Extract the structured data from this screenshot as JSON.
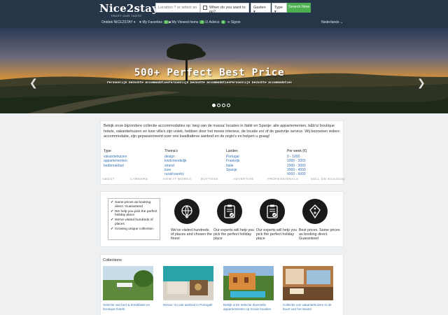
{
  "header": {
    "logo": "Nice2stay",
    "tagline": "TRUST OUR TASTE",
    "search_placeholder": "Location ? or select an accommodation",
    "date_placeholder": "When do you want to go?",
    "guests_label": "Gasten",
    "type_label": "Type",
    "search_button": "Search Now"
  },
  "nav": {
    "about": "Ontdek NICE2STAY",
    "favorites": "My Favorites",
    "favorites_count": "0",
    "viewed": "My Viewed Items",
    "viewed_count": "0",
    "advice": "Advice",
    "advice_count": "0",
    "signin": "Signin",
    "language": "Nederlands"
  },
  "hero": {
    "title": "500+   Perfect  Best Price",
    "subtitle": "Persoonlijk bezochte accommodatiesPersoonlijk bezochte accommodatiesPersoonlijk bezochte accommodaties",
    "slide_active": 1,
    "slide_count": 4
  },
  "intro": {
    "text": "Bekijk onze bijzondere collectie accommodaties op 'weg van de massa' locaties in Italië en Spanje: alle appartementen, b&b's/ boutique hotels, vakantiehuizen en luxe villa's zijn uniek, hebben door het mooie interieur, de locatie en/ of de gastvrije service. Wij bezoeken iedere accommodatie, zijn gepassioneerd over ons kwalitatieve aanbod en de regio's en helpen u graag!",
    "columns": [
      {
        "heading": "Type",
        "links": [
          "vakantiehuizen",
          "appartementen",
          "bedbreakfast"
        ]
      },
      {
        "heading": "Thema's",
        "links": [
          "design",
          "kindvriendelijk",
          "strand",
          "luxe",
          "rural/country"
        ]
      },
      {
        "heading": "Landen",
        "links": [
          "Portugal",
          "Frankrijk",
          "Italie",
          "Spanje"
        ]
      },
      {
        "heading": "Per week (€)",
        "links": [
          "0 - 1000",
          "1000 - 2000",
          "2000 - 3000",
          "3000 - 4000",
          "4000 - 6000"
        ]
      }
    ],
    "footer_links": [
      "ABOUT",
      "CAREERS",
      "HOW IT WORKS",
      "BUTTONS",
      "ADVERTISE",
      "PROFESSIONALS",
      "SELL ON Nice2Stay"
    ]
  },
  "usps": {
    "checklist": [
      "Same prices as booking direct. Guaranteed",
      "We help you pick the perfect holiday place",
      "We've visited hundreds of places",
      "Growing unique collection"
    ],
    "items": [
      {
        "icon": "globe-icon",
        "caption": "We've visited hundreds of places and chosen the finest"
      },
      {
        "icon": "clipboard-check-icon",
        "caption": "Our experts will help you pick the perfect holiday place"
      },
      {
        "icon": "clipboard-check-icon",
        "caption": "Our experts will help you pick the perfect holiday place"
      },
      {
        "icon": "price-tag-icon",
        "caption": "Best prices. Same prices as booking direct. Guaranteed"
      }
    ]
  },
  "collections": {
    "title": "Collections",
    "items": [
      {
        "caption": "Selectie van bed & breakfasts en boutique hotels"
      },
      {
        "caption": "Nieuw: Vu ook aanbod in Portugal!"
      },
      {
        "caption": "Bekijk onze selectie diverselle appartementen op mooie locaties"
      },
      {
        "caption": "Collectie van vakantiehuizen in de buurt van het strand"
      }
    ]
  },
  "colors": {
    "header_bg": "#263547",
    "accent_green": "#4caf50",
    "link_blue": "#3a74b3"
  }
}
